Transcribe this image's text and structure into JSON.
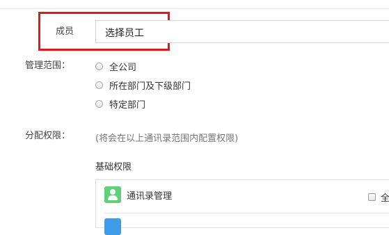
{
  "form": {
    "member_label": "成员",
    "member_value": "选择员工",
    "scope_label": "管理范围：",
    "scope_options": [
      "全公司",
      "所在部门及下级部门",
      "特定部门"
    ],
    "permissions_label": "分配权限：",
    "permissions_hint": "(将会在以上通讯录范围内配置权限)",
    "basic_permissions_title": "基础权限",
    "permission_items": [
      {
        "label": "通讯录管理",
        "icon": "contacts-icon",
        "color": "#5fcf7c"
      }
    ],
    "select_all_label": "全"
  },
  "colors": {
    "highlight": "#e01a1a",
    "contacts_icon": "#5fcf7c",
    "second_icon": "#3f9be6"
  }
}
